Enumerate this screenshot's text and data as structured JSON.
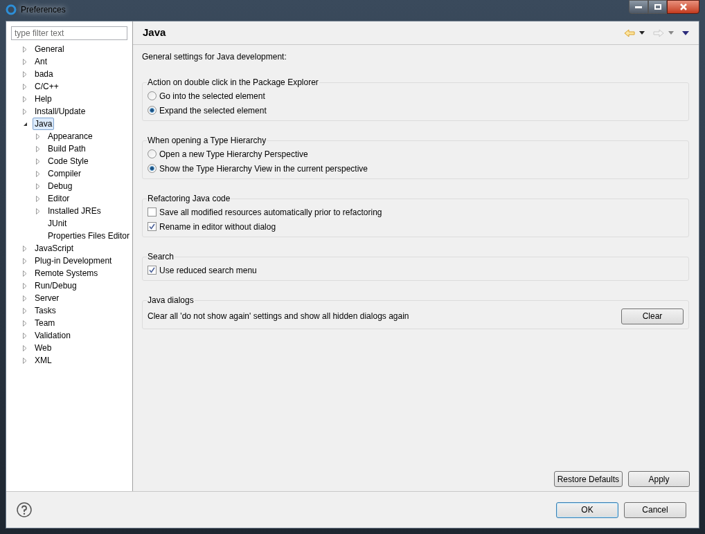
{
  "window": {
    "title": "Preferences"
  },
  "filter": {
    "placeholder": "type filter text"
  },
  "tree": [
    {
      "label": "General",
      "kind": "branch",
      "expanded": false,
      "selected": false
    },
    {
      "label": "Ant",
      "kind": "branch",
      "expanded": false,
      "selected": false
    },
    {
      "label": "bada",
      "kind": "branch",
      "expanded": false,
      "selected": false
    },
    {
      "label": "C/C++",
      "kind": "branch",
      "expanded": false,
      "selected": false
    },
    {
      "label": "Help",
      "kind": "branch",
      "expanded": false,
      "selected": false
    },
    {
      "label": "Install/Update",
      "kind": "branch",
      "expanded": false,
      "selected": false
    },
    {
      "label": "Java",
      "kind": "branch",
      "expanded": true,
      "selected": true,
      "children": [
        {
          "label": "Appearance",
          "kind": "branch",
          "expanded": false,
          "selected": false
        },
        {
          "label": "Build Path",
          "kind": "branch",
          "expanded": false,
          "selected": false
        },
        {
          "label": "Code Style",
          "kind": "branch",
          "expanded": false,
          "selected": false
        },
        {
          "label": "Compiler",
          "kind": "branch",
          "expanded": false,
          "selected": false
        },
        {
          "label": "Debug",
          "kind": "branch",
          "expanded": false,
          "selected": false
        },
        {
          "label": "Editor",
          "kind": "branch",
          "expanded": false,
          "selected": false
        },
        {
          "label": "Installed JREs",
          "kind": "branch",
          "expanded": false,
          "selected": false
        },
        {
          "label": "JUnit",
          "kind": "leaf",
          "selected": false
        },
        {
          "label": "Properties Files Editor",
          "kind": "leaf",
          "selected": false
        }
      ]
    },
    {
      "label": "JavaScript",
      "kind": "branch",
      "expanded": false,
      "selected": false
    },
    {
      "label": "Plug-in Development",
      "kind": "branch",
      "expanded": false,
      "selected": false
    },
    {
      "label": "Remote Systems",
      "kind": "branch",
      "expanded": false,
      "selected": false
    },
    {
      "label": "Run/Debug",
      "kind": "branch",
      "expanded": false,
      "selected": false
    },
    {
      "label": "Server",
      "kind": "branch",
      "expanded": false,
      "selected": false
    },
    {
      "label": "Tasks",
      "kind": "branch",
      "expanded": false,
      "selected": false
    },
    {
      "label": "Team",
      "kind": "branch",
      "expanded": false,
      "selected": false
    },
    {
      "label": "Validation",
      "kind": "branch",
      "expanded": false,
      "selected": false
    },
    {
      "label": "Web",
      "kind": "branch",
      "expanded": false,
      "selected": false
    },
    {
      "label": "XML",
      "kind": "branch",
      "expanded": false,
      "selected": false
    }
  ],
  "page": {
    "title": "Java",
    "description": "General settings for Java development:",
    "groups": [
      {
        "title": "Action on double click in the Package Explorer",
        "items": [
          {
            "kind": "radio",
            "label": "Go into the selected element",
            "selected": false
          },
          {
            "kind": "radio",
            "label": "Expand the selected element",
            "selected": true
          }
        ]
      },
      {
        "title": "When opening a Type Hierarchy",
        "items": [
          {
            "kind": "radio",
            "label": "Open a new Type Hierarchy Perspective",
            "selected": false
          },
          {
            "kind": "radio",
            "label": "Show the Type Hierarchy View in the current perspective",
            "selected": true
          }
        ]
      },
      {
        "title": "Refactoring Java code",
        "items": [
          {
            "kind": "checkbox",
            "label": "Save all modified resources automatically prior to refactoring",
            "checked": false
          },
          {
            "kind": "checkbox",
            "label": "Rename in editor without dialog",
            "checked": true
          }
        ]
      },
      {
        "title": "Search",
        "items": [
          {
            "kind": "checkbox",
            "label": "Use reduced search menu",
            "checked": true
          }
        ]
      },
      {
        "title": "Java dialogs",
        "items": [
          {
            "kind": "action",
            "label": "Clear all 'do not show again' settings and show all hidden dialogs again",
            "button": "Clear"
          }
        ]
      }
    ],
    "buttons": [
      "Restore Defaults",
      "Apply"
    ]
  },
  "dialog_buttons": [
    {
      "label": "OK",
      "default": true
    },
    {
      "label": "Cancel",
      "default": false
    }
  ]
}
